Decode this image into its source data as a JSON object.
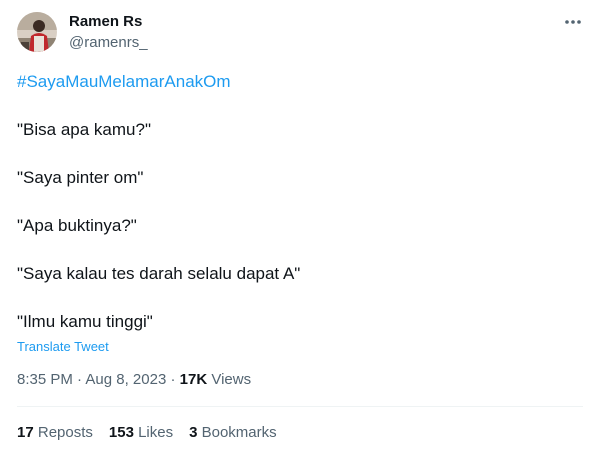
{
  "author": {
    "display_name": "Ramen Rs",
    "handle": "@ramenrs_",
    "avatar_icon": "profile-photo"
  },
  "more_icon": "more-horizontal-icon",
  "tweet": {
    "hashtag": "#SayaMauMelamarAnakOm",
    "lines": [
      "\"Bisa apa kamu?\"",
      "\"Saya pinter om\"",
      "\"Apa buktinya?\"",
      "\"Saya kalau tes darah selalu dapat A\"",
      "\"Ilmu kamu tinggi\""
    ],
    "translate_label": "Translate Tweet"
  },
  "meta": {
    "time": "8:35 PM",
    "separator": " · ",
    "date": "Aug 8, 2023",
    "views_count": "17K",
    "views_label": " Views"
  },
  "stats": {
    "reposts": {
      "count": "17",
      "label": " Reposts"
    },
    "likes": {
      "count": "153",
      "label": " Likes"
    },
    "bookmarks": {
      "count": "3",
      "label": " Bookmarks"
    }
  },
  "colors": {
    "link": "#1d9bf0",
    "secondary_text": "#536471",
    "primary_text": "#0f1419",
    "divider": "#eff3f4"
  }
}
